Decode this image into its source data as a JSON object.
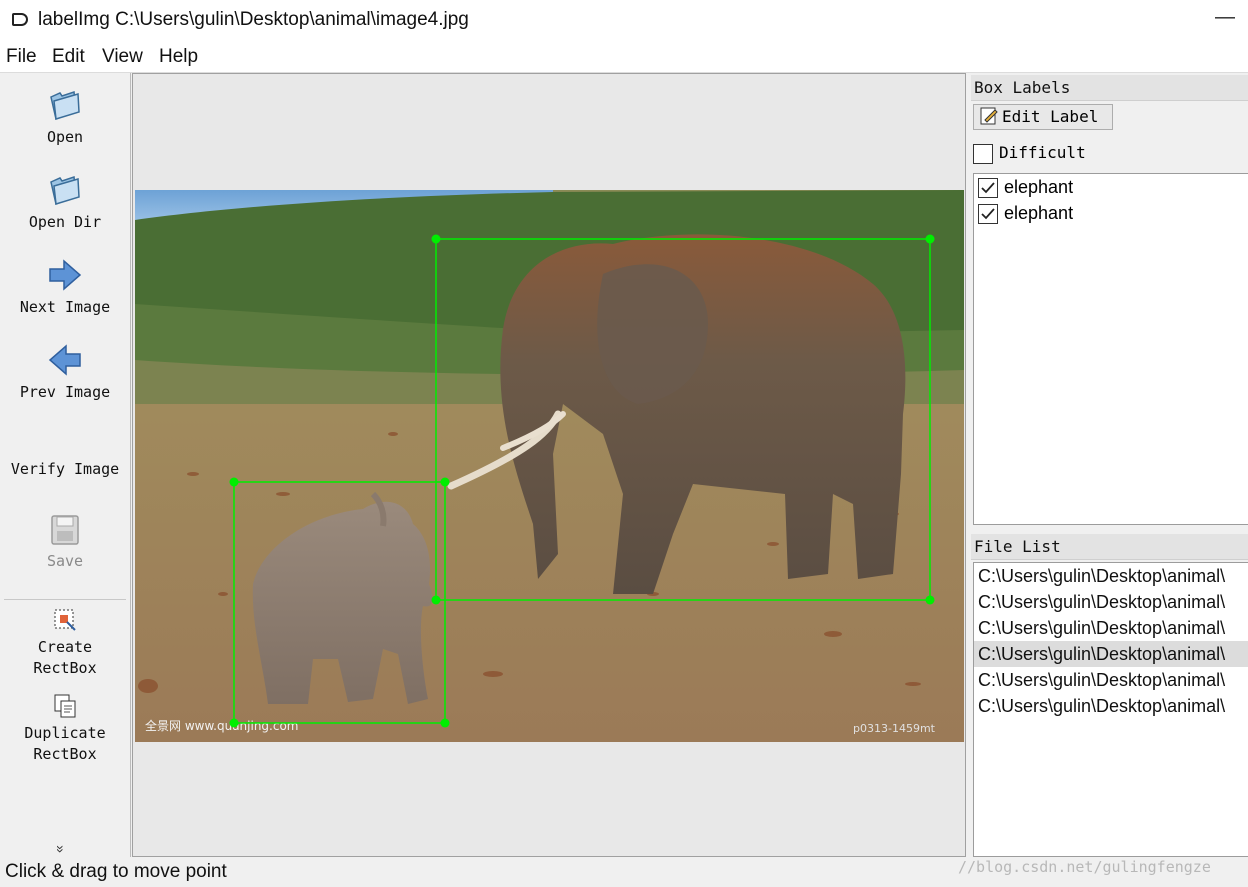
{
  "window": {
    "title": "labelImg C:\\Users\\gulin\\Desktop\\animal\\image4.jpg",
    "minimize": "—"
  },
  "menu": [
    "File",
    "Edit",
    "View",
    "Help"
  ],
  "toolbar": {
    "open": "Open",
    "open_dir": "Open Dir",
    "next_image": "Next Image",
    "prev_image": "Prev Image",
    "verify_image": "Verify Image",
    "save": "Save",
    "create_rectbox_1": "Create",
    "create_rectbox_2": "RectBox",
    "duplicate_rectbox_1": "Duplicate",
    "duplicate_rectbox_2": "RectBox",
    "more": "»"
  },
  "canvas": {
    "photo_watermark_left": "全景网 www.quanjing.com",
    "photo_watermark_right": "p0313-1459mt",
    "box_color": "#00ee00",
    "boxes": [
      "elephant",
      "elephant"
    ]
  },
  "box_labels": {
    "title": "Box Labels",
    "edit_label": "Edit Label",
    "difficult": "Difficult",
    "items": [
      {
        "label": "elephant",
        "checked": true
      },
      {
        "label": "elephant",
        "checked": true
      }
    ]
  },
  "file_list": {
    "title": "File List",
    "items": [
      "C:\\Users\\gulin\\Desktop\\animal\\",
      "C:\\Users\\gulin\\Desktop\\animal\\",
      "C:\\Users\\gulin\\Desktop\\animal\\",
      "C:\\Users\\gulin\\Desktop\\animal\\",
      "C:\\Users\\gulin\\Desktop\\animal\\",
      "C:\\Users\\gulin\\Desktop\\animal\\"
    ],
    "selected_index": 3
  },
  "status": {
    "text": "Click & drag to move point"
  },
  "watermark": "//blog.csdn.net/gulingfengze"
}
